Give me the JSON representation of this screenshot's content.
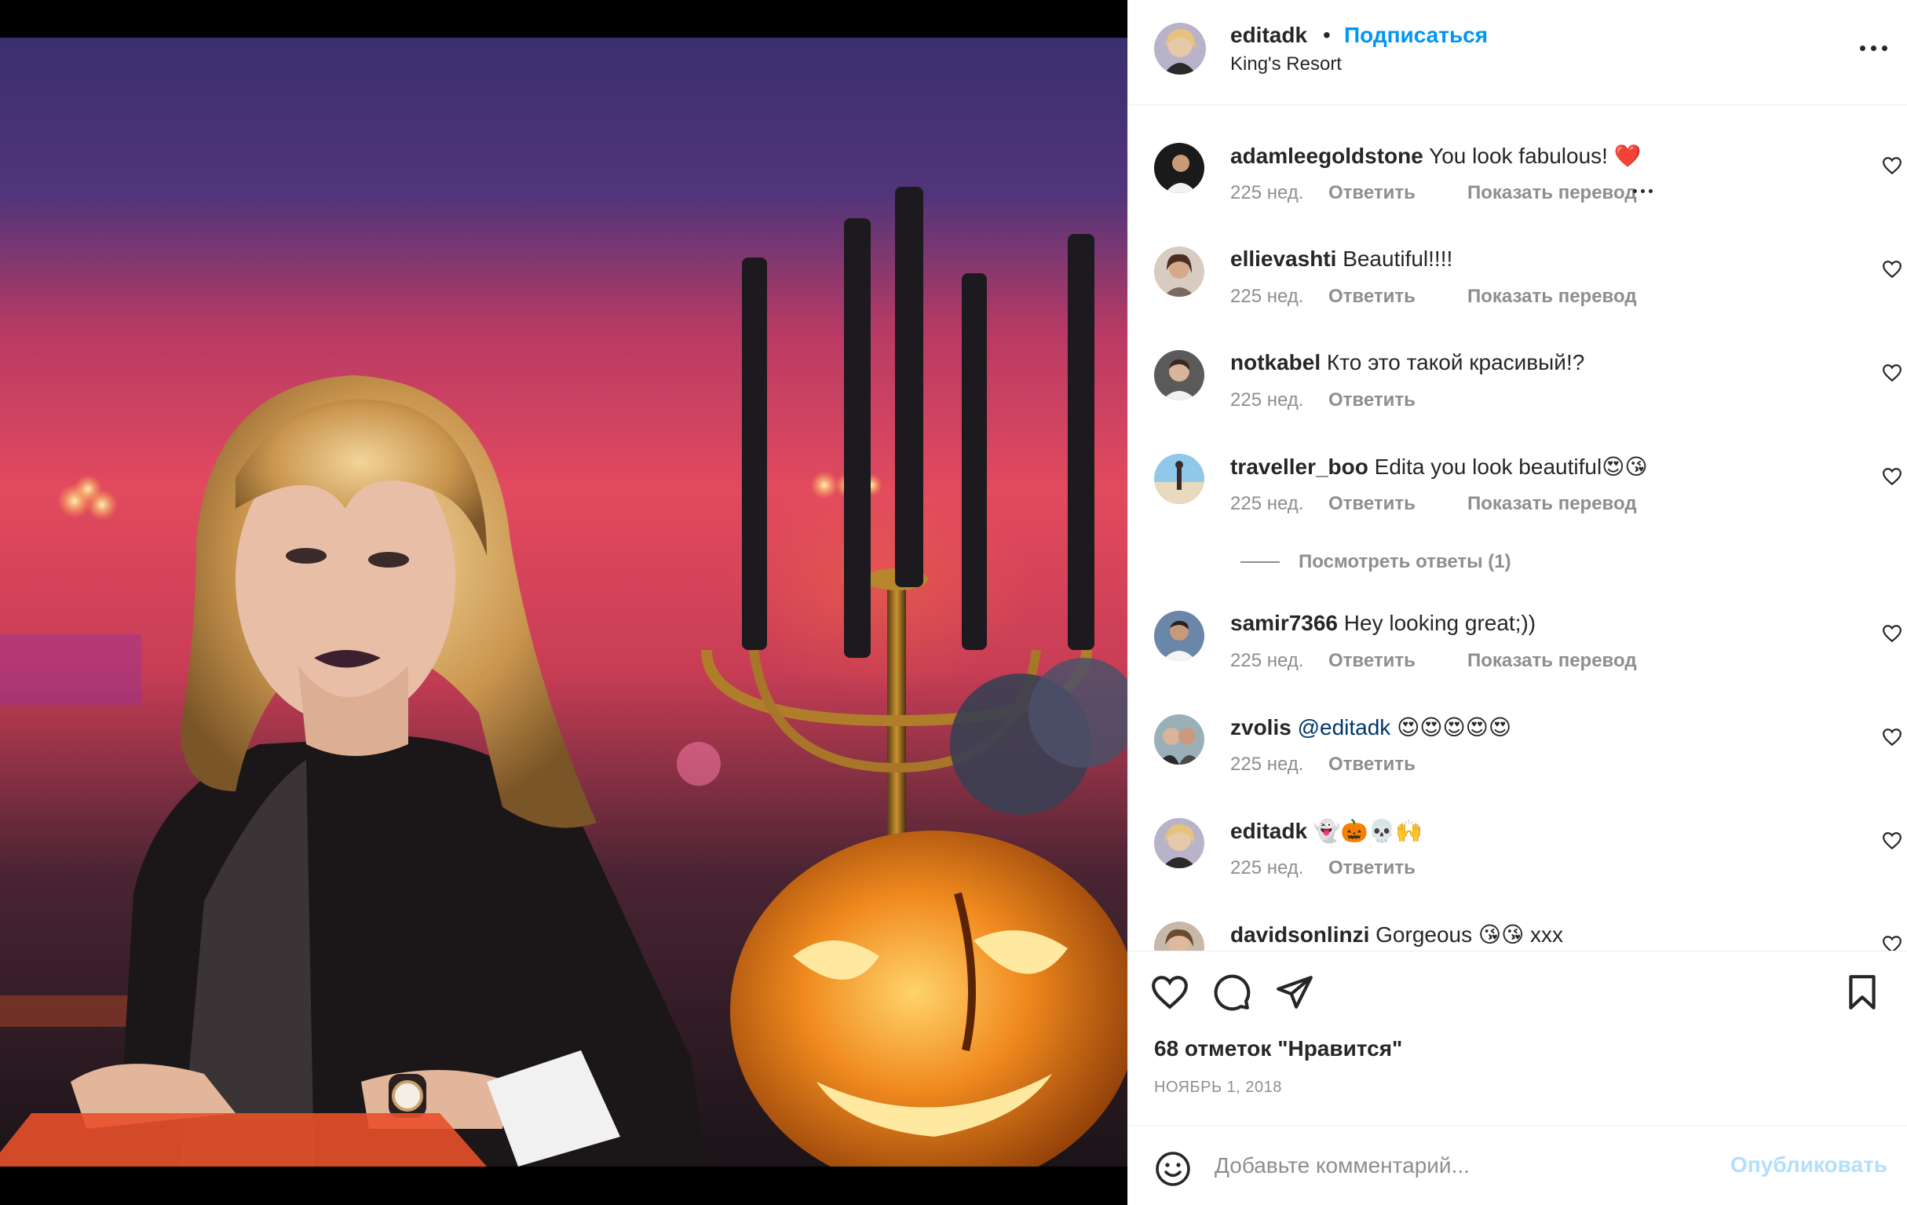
{
  "post": {
    "username": "editadk",
    "separator": "•",
    "follow_label": "Подписаться",
    "location": "King's Resort"
  },
  "comments": [
    {
      "username": "adamleegoldstone",
      "text": "You look fabulous! ❤️",
      "time": "225 нед.",
      "reply_label": "Ответить",
      "translate_label": "Показать перевод",
      "has_more": true
    },
    {
      "username": "ellievashti",
      "text": "Beautiful!!!!",
      "time": "225 нед.",
      "reply_label": "Ответить",
      "translate_label": "Показать перевод"
    },
    {
      "username": "notkabel",
      "text": "Кто это такой красивый!?",
      "time": "225 нед.",
      "reply_label": "Ответить"
    },
    {
      "username": "traveller_boo",
      "text": "Edita you look beautiful😍😘",
      "time": "225 нед.",
      "reply_label": "Ответить",
      "translate_label": "Показать перевод"
    },
    {
      "username": "samir7366",
      "text": "Hey looking great;))",
      "time": "225 нед.",
      "reply_label": "Ответить",
      "translate_label": "Показать перевод"
    },
    {
      "username": "zvolis",
      "mention": "@editadk",
      "text": "😍😍😍😍😍",
      "time": "225 нед.",
      "reply_label": "Ответить"
    },
    {
      "username": "editadk",
      "text": "👻🎃💀🙌",
      "time": "225 нед.",
      "reply_label": "Ответить"
    },
    {
      "username": "davidsonlinzi",
      "text": "Gorgeous 😘😘 xxx"
    }
  ],
  "view_replies": "Посмотреть ответы (1)",
  "likes": "68 отметок \"Нравится\"",
  "date": "НОЯБРЬ 1, 2018",
  "add_comment": {
    "placeholder": "Добавьте комментарий...",
    "publish_label": "Опубликовать"
  },
  "icons": {
    "more": "more-horizontal-icon",
    "like": "heart-icon",
    "comment": "comment-bubble-icon",
    "share": "paper-plane-icon",
    "save": "bookmark-icon",
    "emoji": "emoji-smile-icon"
  },
  "colors": {
    "link_blue": "#0095f6",
    "publish_disabled": "#b2dffc",
    "secondary_text": "#8e8e8e",
    "mention": "#00376b"
  }
}
